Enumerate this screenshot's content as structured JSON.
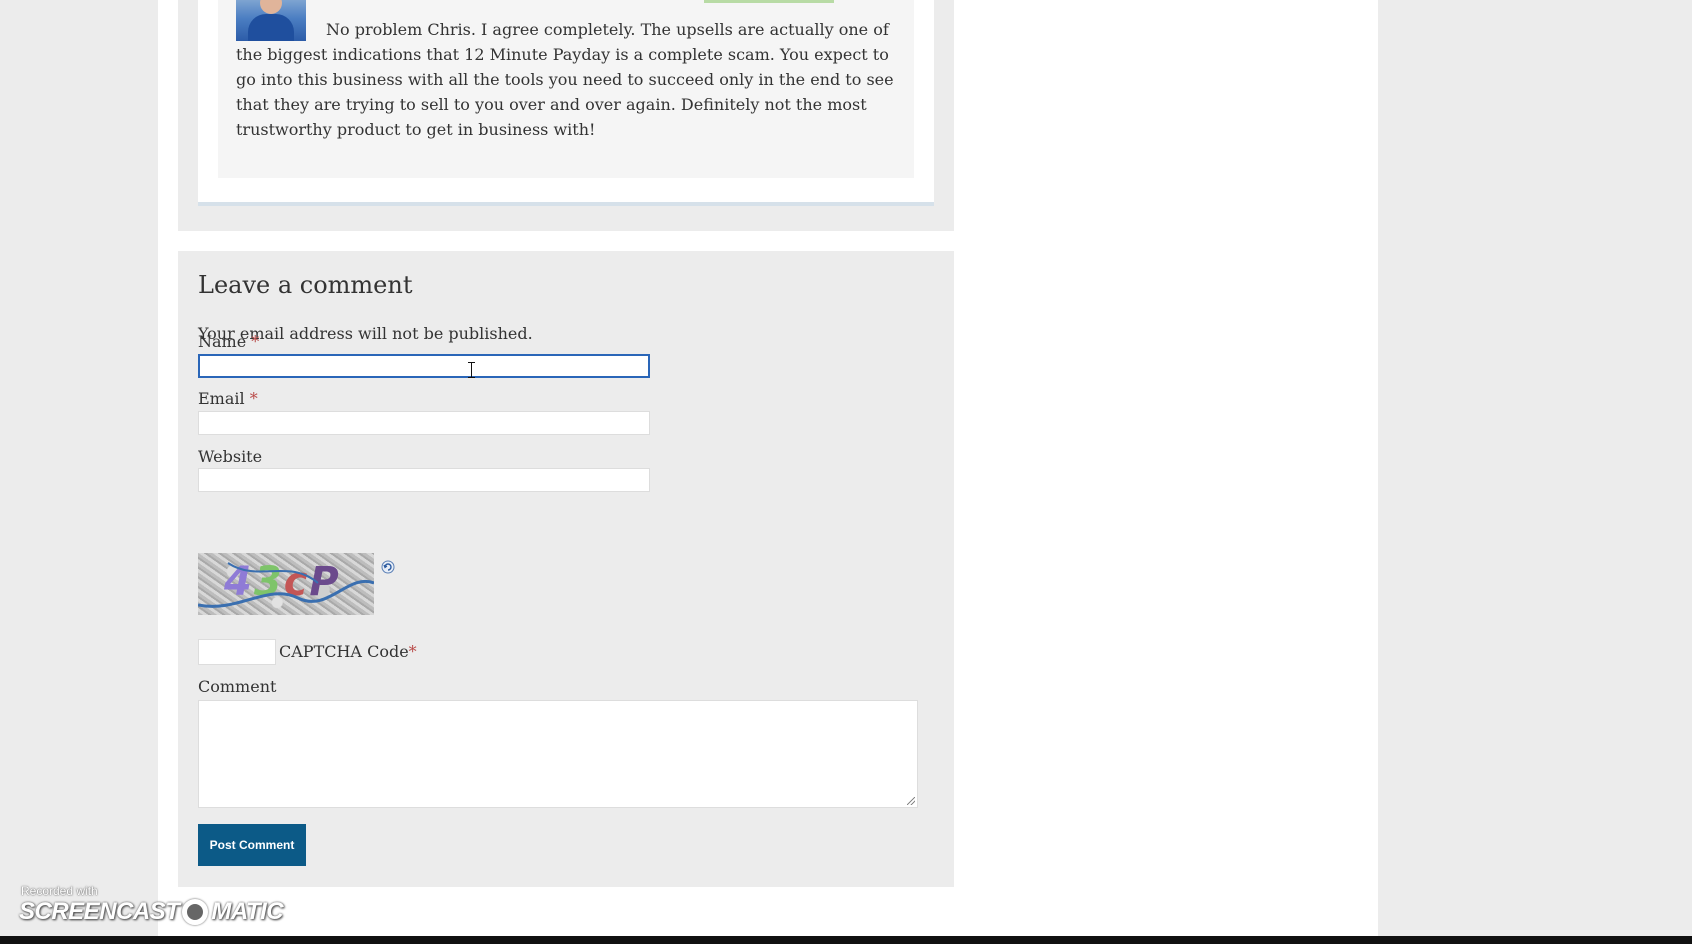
{
  "previous_comment": {
    "text": "No problem Chris. I agree completely. The upsells are actually one of the biggest indications that 12 Minute Payday is a complete scam. You expect to go into this business with all the tools you need to succeed only in the end to see that they are trying to sell to you over and over again. Definitely not the most trustworthy product to get in business with!"
  },
  "respond": {
    "title": "Leave a comment",
    "notes": "Your email address will not be published.",
    "name_label": "Name",
    "email_label": "Email",
    "website_label": "Website",
    "required_mark": "*",
    "captcha_image_text": [
      "4",
      "3",
      "c",
      "P"
    ],
    "captcha_label": "CAPTCHA Code",
    "comment_label": "Comment",
    "submit_label": "Post Comment",
    "name_value": "",
    "email_value": "",
    "website_value": "",
    "captcha_value": "",
    "comment_value": ""
  },
  "watermark": {
    "line1": "Recorded with",
    "brand_left": "SCREENCAST",
    "brand_right": "MATIC"
  },
  "colors": {
    "button_bg": "#0c5a87",
    "focus_border": "#2a66b8",
    "required": "#b94a48",
    "page_bg": "#ececec"
  }
}
